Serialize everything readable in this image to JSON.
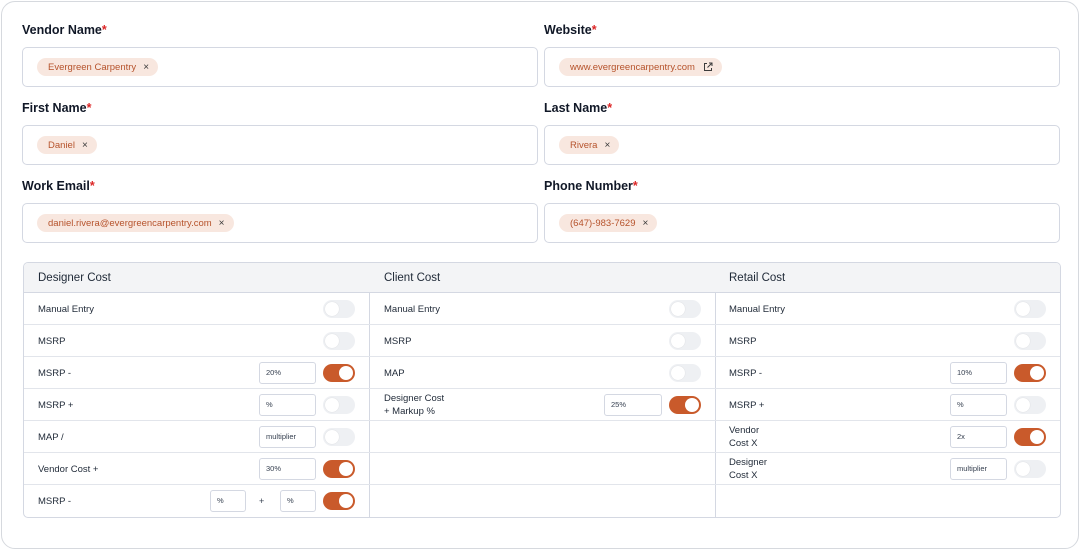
{
  "colors": {
    "accent": "#c95a2b",
    "chip_bg": "#f8e7df",
    "chip_text": "#b6532c",
    "required": "#dc2626"
  },
  "form": {
    "vendor_name": {
      "label": "Vendor Name",
      "required": "*",
      "value": "Evergreen Carpentry"
    },
    "website": {
      "label": "Website",
      "required": "*",
      "value": "www.evergreencarpentry.com"
    },
    "first_name": {
      "label": "First Name",
      "required": "*",
      "value": "Daniel"
    },
    "last_name": {
      "label": "Last Name",
      "required": "*",
      "value": "Rivera"
    },
    "work_email": {
      "label": "Work Email",
      "required": "*",
      "value": "daniel.rivera@evergreencarpentry.com"
    },
    "phone": {
      "label": "Phone Number",
      "required": "*",
      "value": "(647)-983-7629"
    },
    "remove_glyph": "×"
  },
  "pricing": {
    "designer": {
      "title": "Designer Cost",
      "rows": [
        {
          "label": "Manual Entry",
          "on": false
        },
        {
          "label": "MSRP",
          "on": false
        },
        {
          "label": "MSRP -",
          "value": "20%",
          "on": true
        },
        {
          "label": "MSRP +",
          "placeholder": "%",
          "on": false
        },
        {
          "label": "MAP /",
          "placeholder": "multiplier",
          "on": false
        },
        {
          "label": "Vendor Cost +",
          "value": "30%",
          "on": true
        },
        {
          "label": "MSRP -",
          "placeholder_a": "%",
          "plus": "+",
          "placeholder_b": "%",
          "on": true
        }
      ]
    },
    "client": {
      "title": "Client Cost",
      "rows": [
        {
          "label": "Manual Entry",
          "on": false
        },
        {
          "label": "MSRP",
          "on": false
        },
        {
          "label": "MAP",
          "on": false
        },
        {
          "label_line1": "Designer Cost",
          "label_line2": "+ Markup %",
          "value": "25%",
          "on": true
        }
      ]
    },
    "retail": {
      "title": "Retail Cost",
      "rows": [
        {
          "label": "Manual Entry",
          "on": false
        },
        {
          "label": "MSRP",
          "on": false
        },
        {
          "label": "MSRP -",
          "value": "10%",
          "on": true
        },
        {
          "label": "MSRP +",
          "placeholder": "%",
          "on": false
        },
        {
          "label_line1": "Vendor",
          "label_line2": "Cost X",
          "value": "2x",
          "on": true
        },
        {
          "label_line1": "Designer",
          "label_line2": "Cost X",
          "placeholder": "multiplier",
          "on": false
        }
      ]
    }
  }
}
